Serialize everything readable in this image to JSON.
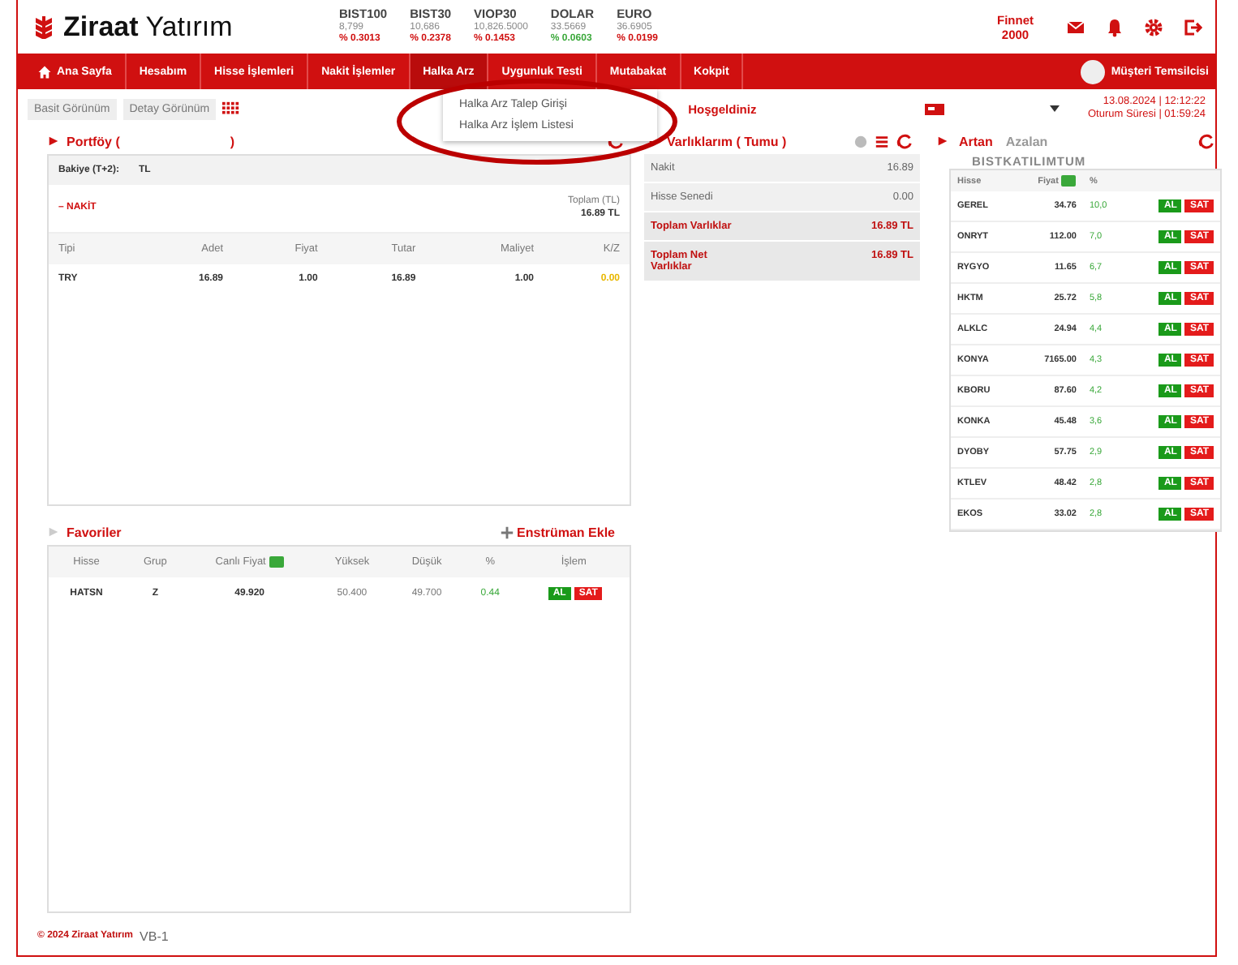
{
  "header": {
    "logo_bold": "Ziraat",
    "logo_light": "Yatırım",
    "tickers": [
      {
        "name": "BIST100",
        "value": "8,799",
        "change": "% 0.3013",
        "color": "#d01010"
      },
      {
        "name": "BIST30",
        "value": "10,686",
        "change": "% 0.2378",
        "color": "#d01010"
      },
      {
        "name": "VIOP30",
        "value": "10,826.5000",
        "change": "% 0.1453",
        "color": "#d01010"
      },
      {
        "name": "DOLAR",
        "value": "33.5669",
        "change": "% 0.0603",
        "color": "#3aa83a"
      },
      {
        "name": "EURO",
        "value": "36.6905",
        "change": "% 0.0199",
        "color": "#d01010"
      }
    ],
    "user_line1": "Finnet",
    "user_line2": "2000"
  },
  "nav": {
    "items": [
      {
        "label": "Ana Sayfa",
        "expanded": false
      },
      {
        "label": "Hesabım",
        "expanded": false
      },
      {
        "label": "Hisse İşlemleri",
        "expanded": false
      },
      {
        "label": "Nakit İşlemler",
        "expanded": false
      },
      {
        "label": "Halka Arz",
        "expanded": true
      },
      {
        "label": "Uygunluk Testi",
        "expanded": false
      },
      {
        "label": "Mutabakat",
        "expanded": false
      },
      {
        "label": "Kokpit",
        "expanded": false
      }
    ],
    "account": "Müşteri Temsilcisi",
    "dropdown": [
      "Halka Arz Talep Girişi",
      "Halka Arz İşlem Listesi"
    ]
  },
  "view_tabs": [
    "Basit Görünüm",
    "Detay Görünüm"
  ],
  "welcome": "Hoşgeldiniz",
  "date": "13.08.2024 | 12:12:22",
  "session": "Oturum Süresi | 01:59:24",
  "portfolio": {
    "title": "Portföy (",
    "title_end": ")",
    "balance_label": "Bakiye (T+2):",
    "balance_unit": "TL",
    "section": "– NAKİT",
    "total_label": "Toplam (TL)",
    "total": "16.89 TL",
    "columns": [
      "Tipi",
      "Adet",
      "Fiyat",
      "Tutar",
      "Maliyet",
      "K/Z"
    ],
    "rows": [
      [
        "TRY",
        "16.89",
        "1.00",
        "16.89",
        "1.00",
        "0.00"
      ]
    ]
  },
  "assets": {
    "title": "Varlıklarım ( Tumu )",
    "rows": [
      {
        "label": "Nakit",
        "value": "16.89",
        "kind": "plain"
      },
      {
        "label": "Hisse Senedi",
        "value": "0.00",
        "kind": "plain"
      },
      {
        "label": "Toplam Varlıklar",
        "value": "16.89 TL",
        "kind": "total"
      },
      {
        "label": "Toplam Net Varlıklar",
        "value": "16.89 TL",
        "kind": "total"
      }
    ]
  },
  "movers": {
    "tabs": [
      {
        "label": "Artan",
        "selected": true
      },
      {
        "label": "Azalan",
        "selected": false
      }
    ],
    "market": "BISTKATILIMTUM",
    "columns": [
      "Hisse",
      "Fiyat",
      "%"
    ],
    "rows": [
      {
        "name": "GEREL",
        "price": "34.76",
        "pct": "10,0",
        "buy": "AL",
        "sell": "SAT"
      },
      {
        "name": "ONRYT",
        "price": "112.00",
        "pct": "7,0",
        "buy": "AL",
        "sell": "SAT"
      },
      {
        "name": "RYGYO",
        "price": "11.65",
        "pct": "6,7",
        "buy": "AL",
        "sell": "SAT"
      },
      {
        "name": "HKTM",
        "price": "25.72",
        "pct": "5,8",
        "buy": "AL",
        "sell": "SAT"
      },
      {
        "name": "ALKLC",
        "price": "24.94",
        "pct": "4,4",
        "buy": "AL",
        "sell": "SAT"
      },
      {
        "name": "KONYA",
        "price": "7165.00",
        "pct": "4,3",
        "buy": "AL",
        "sell": "SAT"
      },
      {
        "name": "KBORU",
        "price": "87.60",
        "pct": "4,2",
        "buy": "AL",
        "sell": "SAT"
      },
      {
        "name": "KONKA",
        "price": "45.48",
        "pct": "3,6",
        "buy": "AL",
        "sell": "SAT"
      },
      {
        "name": "DYOBY",
        "price": "57.75",
        "pct": "2,9",
        "buy": "AL",
        "sell": "SAT"
      },
      {
        "name": "KTLEV",
        "price": "48.42",
        "pct": "2,8",
        "buy": "AL",
        "sell": "SAT"
      },
      {
        "name": "EKOS",
        "price": "33.02",
        "pct": "2,8",
        "buy": "AL",
        "sell": "SAT"
      }
    ]
  },
  "favorites": {
    "title": "Favoriler",
    "add": "Enstrüman Ekle",
    "columns": [
      "Hisse",
      "Grup",
      "Canlı Fiyat",
      "Yüksek",
      "Düşük",
      "%",
      "İşlem"
    ],
    "rows": [
      {
        "name": "HATSN",
        "group": "Z",
        "price": "49.920",
        "high": "50.400",
        "low": "49.700",
        "pct": "0.44",
        "buy": "AL",
        "sell": "SAT"
      }
    ]
  },
  "footer": {
    "copyright": "© 2024 Ziraat Yatırım",
    "version": "VB-1"
  }
}
